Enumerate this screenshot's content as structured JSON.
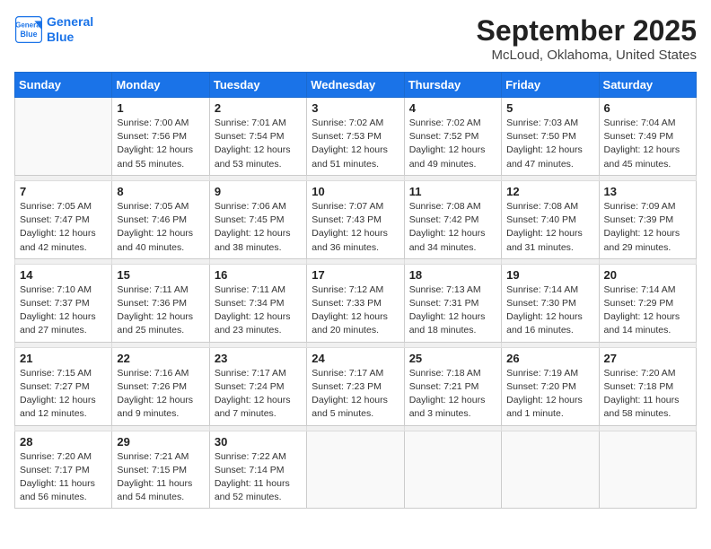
{
  "header": {
    "logo_line1": "General",
    "logo_line2": "Blue",
    "title": "September 2025",
    "subtitle": "McLoud, Oklahoma, United States"
  },
  "weekdays": [
    "Sunday",
    "Monday",
    "Tuesday",
    "Wednesday",
    "Thursday",
    "Friday",
    "Saturday"
  ],
  "weeks": [
    [
      {
        "day": "",
        "info": ""
      },
      {
        "day": "1",
        "info": "Sunrise: 7:00 AM\nSunset: 7:56 PM\nDaylight: 12 hours\nand 55 minutes."
      },
      {
        "day": "2",
        "info": "Sunrise: 7:01 AM\nSunset: 7:54 PM\nDaylight: 12 hours\nand 53 minutes."
      },
      {
        "day": "3",
        "info": "Sunrise: 7:02 AM\nSunset: 7:53 PM\nDaylight: 12 hours\nand 51 minutes."
      },
      {
        "day": "4",
        "info": "Sunrise: 7:02 AM\nSunset: 7:52 PM\nDaylight: 12 hours\nand 49 minutes."
      },
      {
        "day": "5",
        "info": "Sunrise: 7:03 AM\nSunset: 7:50 PM\nDaylight: 12 hours\nand 47 minutes."
      },
      {
        "day": "6",
        "info": "Sunrise: 7:04 AM\nSunset: 7:49 PM\nDaylight: 12 hours\nand 45 minutes."
      }
    ],
    [
      {
        "day": "7",
        "info": "Sunrise: 7:05 AM\nSunset: 7:47 PM\nDaylight: 12 hours\nand 42 minutes."
      },
      {
        "day": "8",
        "info": "Sunrise: 7:05 AM\nSunset: 7:46 PM\nDaylight: 12 hours\nand 40 minutes."
      },
      {
        "day": "9",
        "info": "Sunrise: 7:06 AM\nSunset: 7:45 PM\nDaylight: 12 hours\nand 38 minutes."
      },
      {
        "day": "10",
        "info": "Sunrise: 7:07 AM\nSunset: 7:43 PM\nDaylight: 12 hours\nand 36 minutes."
      },
      {
        "day": "11",
        "info": "Sunrise: 7:08 AM\nSunset: 7:42 PM\nDaylight: 12 hours\nand 34 minutes."
      },
      {
        "day": "12",
        "info": "Sunrise: 7:08 AM\nSunset: 7:40 PM\nDaylight: 12 hours\nand 31 minutes."
      },
      {
        "day": "13",
        "info": "Sunrise: 7:09 AM\nSunset: 7:39 PM\nDaylight: 12 hours\nand 29 minutes."
      }
    ],
    [
      {
        "day": "14",
        "info": "Sunrise: 7:10 AM\nSunset: 7:37 PM\nDaylight: 12 hours\nand 27 minutes."
      },
      {
        "day": "15",
        "info": "Sunrise: 7:11 AM\nSunset: 7:36 PM\nDaylight: 12 hours\nand 25 minutes."
      },
      {
        "day": "16",
        "info": "Sunrise: 7:11 AM\nSunset: 7:34 PM\nDaylight: 12 hours\nand 23 minutes."
      },
      {
        "day": "17",
        "info": "Sunrise: 7:12 AM\nSunset: 7:33 PM\nDaylight: 12 hours\nand 20 minutes."
      },
      {
        "day": "18",
        "info": "Sunrise: 7:13 AM\nSunset: 7:31 PM\nDaylight: 12 hours\nand 18 minutes."
      },
      {
        "day": "19",
        "info": "Sunrise: 7:14 AM\nSunset: 7:30 PM\nDaylight: 12 hours\nand 16 minutes."
      },
      {
        "day": "20",
        "info": "Sunrise: 7:14 AM\nSunset: 7:29 PM\nDaylight: 12 hours\nand 14 minutes."
      }
    ],
    [
      {
        "day": "21",
        "info": "Sunrise: 7:15 AM\nSunset: 7:27 PM\nDaylight: 12 hours\nand 12 minutes."
      },
      {
        "day": "22",
        "info": "Sunrise: 7:16 AM\nSunset: 7:26 PM\nDaylight: 12 hours\nand 9 minutes."
      },
      {
        "day": "23",
        "info": "Sunrise: 7:17 AM\nSunset: 7:24 PM\nDaylight: 12 hours\nand 7 minutes."
      },
      {
        "day": "24",
        "info": "Sunrise: 7:17 AM\nSunset: 7:23 PM\nDaylight: 12 hours\nand 5 minutes."
      },
      {
        "day": "25",
        "info": "Sunrise: 7:18 AM\nSunset: 7:21 PM\nDaylight: 12 hours\nand 3 minutes."
      },
      {
        "day": "26",
        "info": "Sunrise: 7:19 AM\nSunset: 7:20 PM\nDaylight: 12 hours\nand 1 minute."
      },
      {
        "day": "27",
        "info": "Sunrise: 7:20 AM\nSunset: 7:18 PM\nDaylight: 11 hours\nand 58 minutes."
      }
    ],
    [
      {
        "day": "28",
        "info": "Sunrise: 7:20 AM\nSunset: 7:17 PM\nDaylight: 11 hours\nand 56 minutes."
      },
      {
        "day": "29",
        "info": "Sunrise: 7:21 AM\nSunset: 7:15 PM\nDaylight: 11 hours\nand 54 minutes."
      },
      {
        "day": "30",
        "info": "Sunrise: 7:22 AM\nSunset: 7:14 PM\nDaylight: 11 hours\nand 52 minutes."
      },
      {
        "day": "",
        "info": ""
      },
      {
        "day": "",
        "info": ""
      },
      {
        "day": "",
        "info": ""
      },
      {
        "day": "",
        "info": ""
      }
    ]
  ]
}
